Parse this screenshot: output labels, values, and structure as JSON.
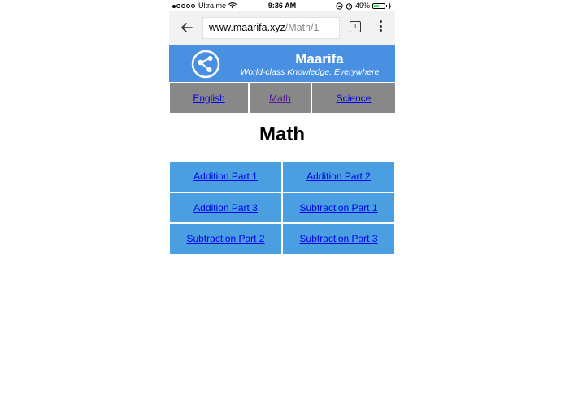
{
  "status_bar": {
    "carrier": "Ultra.me",
    "time": "9:36 AM",
    "battery": "49%",
    "battery_level": 0.49
  },
  "browser": {
    "url_domain": "www.maarifa.xyz",
    "url_path": "/Math/1",
    "tab_count": "1"
  },
  "site": {
    "title": "Maarifa",
    "tagline": "World-class Knowledge, Everywhere",
    "brand_color": "#4a90e2"
  },
  "nav": {
    "items": [
      {
        "label": "English"
      },
      {
        "label": "Math"
      },
      {
        "label": "Science"
      }
    ]
  },
  "page": {
    "title": "Math",
    "lessons": [
      {
        "label": "Addition Part 1"
      },
      {
        "label": "Addition Part 2"
      },
      {
        "label": "Addition Part 3"
      },
      {
        "label": "Subtraction Part 1"
      },
      {
        "label": "Subtraction Part 2"
      },
      {
        "label": "Subtraction Part 3"
      }
    ]
  }
}
